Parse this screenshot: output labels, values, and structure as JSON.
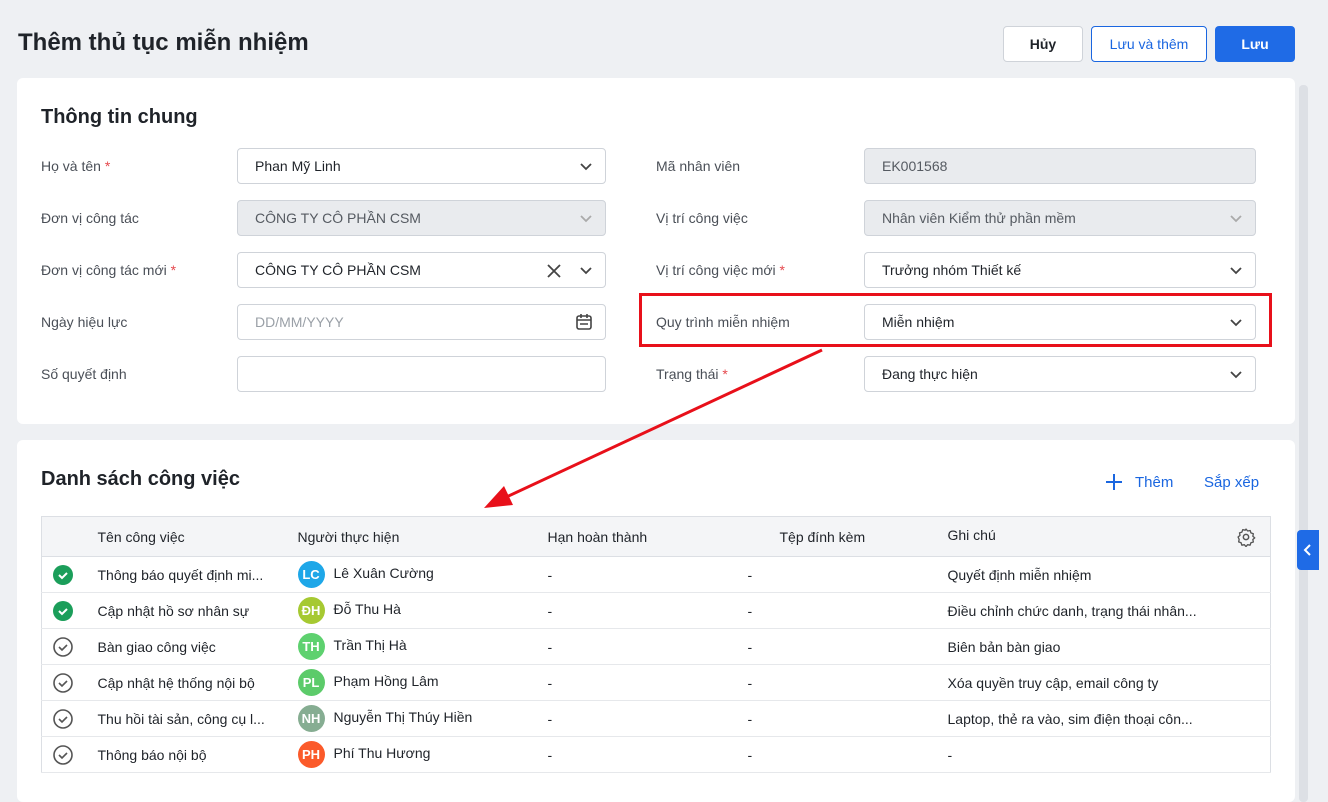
{
  "page": {
    "title": "Thêm thủ tục miễn nhiệm",
    "cancel": "Hủy",
    "save_add": "Lưu và thêm",
    "save": "Lưu"
  },
  "general": {
    "title": "Thông tin chung",
    "full_name": {
      "label": "Họ và tên",
      "value": "Phan Mỹ Linh"
    },
    "employee_code": {
      "label": "Mã nhân viên",
      "value": "EK001568"
    },
    "unit": {
      "label": "Đơn vị công tác",
      "value": "CÔNG TY CÔ PHẦN CSM"
    },
    "position": {
      "label": "Vị trí công việc",
      "value": "Nhân viên Kiểm thử phần mềm"
    },
    "new_unit": {
      "label": "Đơn vị công tác mới",
      "value": "CÔNG TY CÔ PHẦN CSM"
    },
    "new_position": {
      "label": "Vị trí công việc mới",
      "value": "Trưởng nhóm Thiết kế"
    },
    "effective_date": {
      "label": "Ngày hiệu lực",
      "placeholder": "DD/MM/YYYY"
    },
    "process": {
      "label": "Quy trình miễn nhiệm",
      "value": "Miễn nhiệm"
    },
    "decision_no": {
      "label": "Số quyết định",
      "value": ""
    },
    "status": {
      "label": "Trạng thái",
      "value": "Đang thực hiện"
    },
    "required_mark": "*"
  },
  "tasks": {
    "title": "Danh sách công việc",
    "add": "Thêm",
    "sort": "Sắp xếp",
    "columns": [
      "Tên công việc",
      "Người thực hiện",
      "Hạn hoàn thành",
      "Tệp đính kèm",
      "Ghi chú"
    ],
    "rows": [
      {
        "done": true,
        "name": "Thông báo quyết định mi...",
        "initials": "LC",
        "color": "#1ea7e8",
        "person": "Lê Xuân Cường",
        "deadline": "-",
        "file": "-",
        "note": "Quyết định miễn nhiệm"
      },
      {
        "done": true,
        "name": "Cập nhật hồ sơ nhân sự",
        "initials": "ĐH",
        "color": "#a6c932",
        "person": "Đỗ Thu Hà",
        "deadline": "-",
        "file": "-",
        "note": "Điều chỉnh chức danh, trạng thái nhân..."
      },
      {
        "done": false,
        "name": "Bàn giao công việc",
        "initials": "TH",
        "color": "#5ed16f",
        "person": "Trần Thị Hà",
        "deadline": "-",
        "file": "-",
        "note": "Biên bản bàn giao"
      },
      {
        "done": false,
        "name": "Cập nhật hệ thống nội bộ",
        "initials": "PL",
        "color": "#5ccb6a",
        "person": "Phạm Hồng Lâm",
        "deadline": "-",
        "file": "-",
        "note": "Xóa quyền truy cập, email công ty"
      },
      {
        "done": false,
        "name": "Thu hồi tài sản, công cụ l...",
        "initials": "NH",
        "color": "#86ad92",
        "person": "Nguyễn Thị Thúy Hiền",
        "deadline": "-",
        "file": "-",
        "note": "Laptop, thẻ ra vào, sim điện thoại côn..."
      },
      {
        "done": false,
        "name": "Thông báo nội bộ",
        "initials": "PH",
        "color": "#fb5a2a",
        "person": "Phí Thu Hương",
        "deadline": "-",
        "file": "-",
        "note": "-"
      }
    ]
  }
}
